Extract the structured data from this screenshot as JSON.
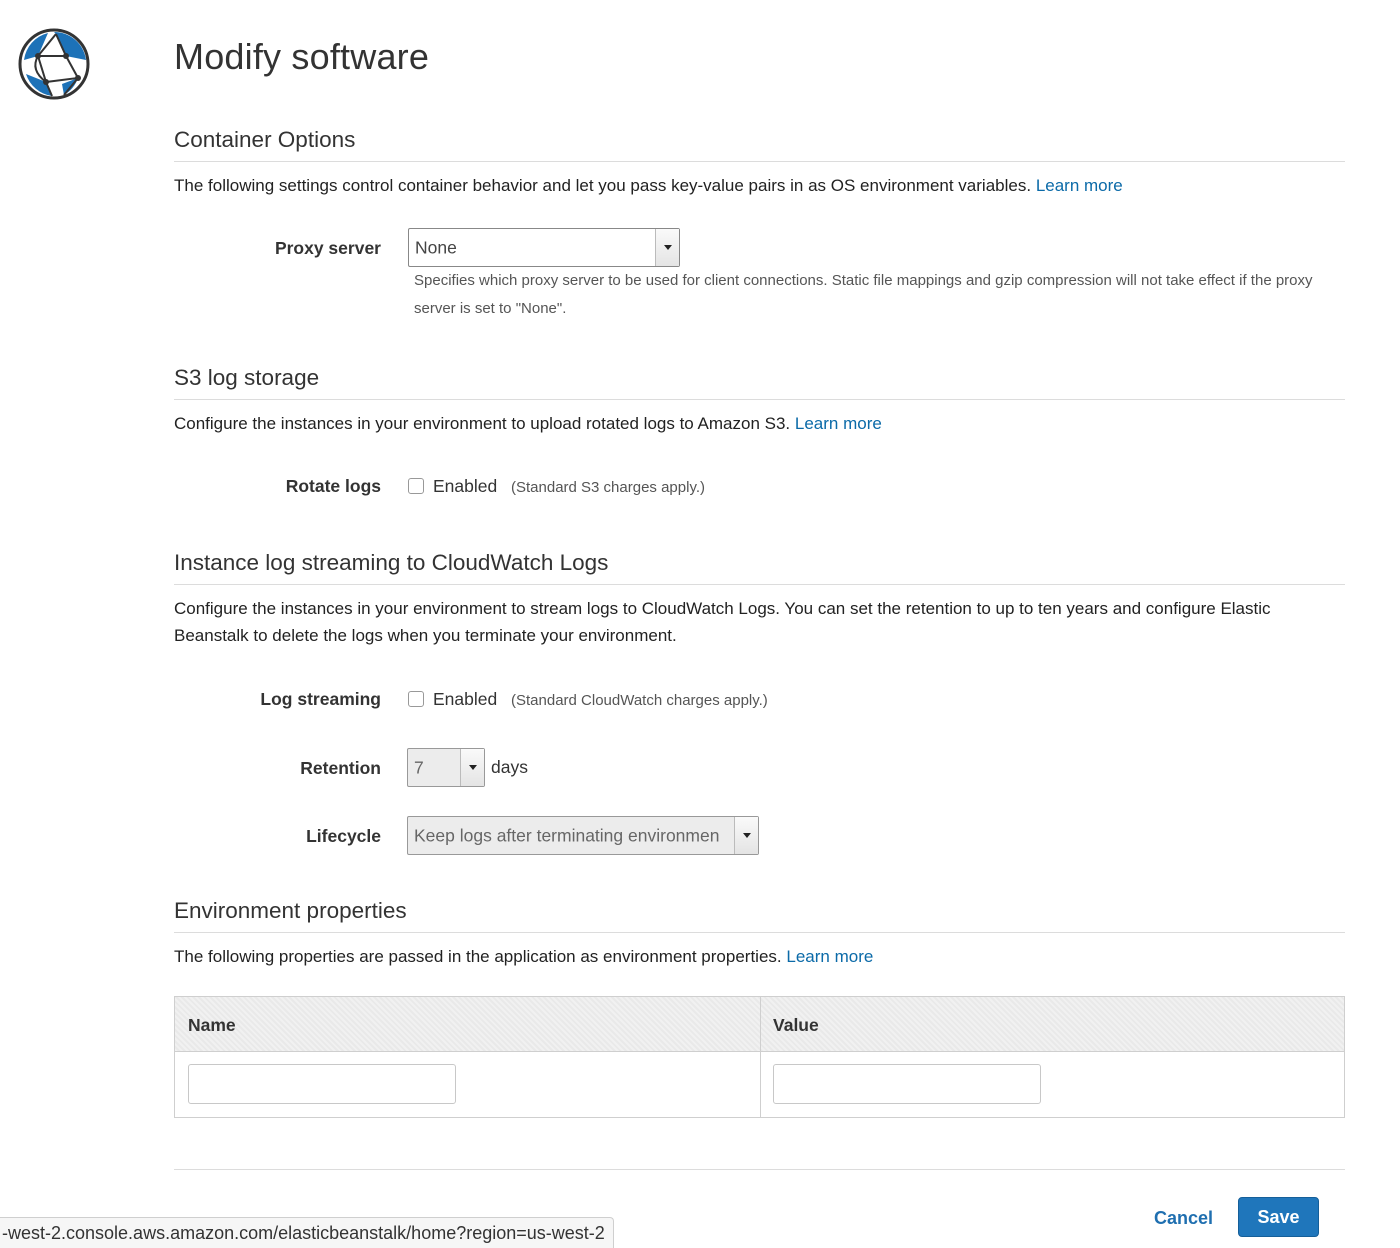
{
  "page": {
    "title": "Modify software",
    "logo_icon": "globe-network-icon"
  },
  "container_options": {
    "heading": "Container Options",
    "description": "The following settings control container behavior and let you pass key-value pairs in as OS environment variables.",
    "learn_more": "Learn more",
    "proxy_server": {
      "label": "Proxy server",
      "value": "None",
      "help": "Specifies which proxy server to be used for client connections. Static file mappings and gzip compression will not take effect if the proxy server is set to \"None\"."
    }
  },
  "s3_log_storage": {
    "heading": "S3 log storage",
    "description": "Configure the instances in your environment to upload rotated logs to Amazon S3.",
    "learn_more": "Learn more",
    "rotate_logs": {
      "label": "Rotate logs",
      "checkbox_label": "Enabled",
      "checked": false,
      "note": "(Standard S3 charges apply.)"
    }
  },
  "cloudwatch": {
    "heading": "Instance log streaming to CloudWatch Logs",
    "description": "Configure the instances in your environment to stream logs to CloudWatch Logs. You can set the retention to up to ten years and configure Elastic Beanstalk to delete the logs when you terminate your environment.",
    "log_streaming": {
      "label": "Log streaming",
      "checkbox_label": "Enabled",
      "checked": false,
      "note": "(Standard CloudWatch charges apply.)"
    },
    "retention": {
      "label": "Retention",
      "value": "7",
      "unit": "days"
    },
    "lifecycle": {
      "label": "Lifecycle",
      "value": "Keep logs after terminating environmen"
    }
  },
  "environment_properties": {
    "heading": "Environment properties",
    "description": "The following properties are passed in the application as environment properties.",
    "learn_more": "Learn more",
    "columns": [
      "Name",
      "Value"
    ],
    "rows": [
      {
        "name": "",
        "value": ""
      }
    ]
  },
  "actions": {
    "cancel": "Cancel",
    "save": "Save"
  },
  "status_bar": {
    "url": "-west-2.console.aws.amazon.com/elasticbeanstalk/home?region=us-west-2"
  },
  "colors": {
    "link": "#0b6aa8",
    "primary_button": "#1f76bb",
    "logo_blue": "#1d72b8"
  }
}
